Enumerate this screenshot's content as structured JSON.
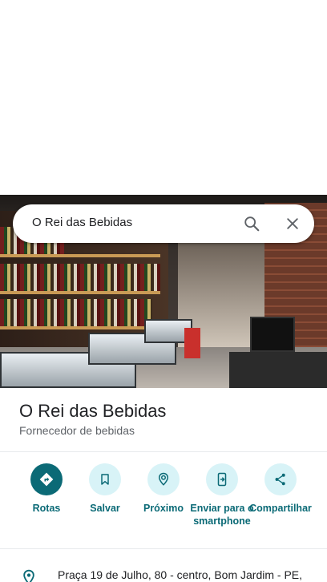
{
  "search": {
    "query": "O Rei das Bebidas",
    "search_icon": "search-icon",
    "clear_icon": "close-icon"
  },
  "photo": {
    "subject": "store-photo"
  },
  "place": {
    "name": "O Rei das Bebidas",
    "category": "Fornecedor de bebidas"
  },
  "actions": [
    {
      "id": "rotas",
      "label": "Rotas",
      "icon": "directions-icon"
    },
    {
      "id": "salvar",
      "label": "Salvar",
      "icon": "bookmark-icon"
    },
    {
      "id": "proximo",
      "label": "Próximo",
      "icon": "nearby-icon"
    },
    {
      "id": "enviar",
      "label": "Enviar para o smartphone",
      "icon": "send-to-phone-icon"
    },
    {
      "id": "compartilhar",
      "label": "Compartilhar",
      "icon": "share-icon"
    }
  ],
  "address": {
    "text": "Praça 19 de Julho, 80 - centro, Bom Jardim - PE,",
    "icon": "location-pin-icon"
  },
  "colors": {
    "accent": "#0b6a76",
    "accent_light": "#d8f3f7",
    "text": "#202124",
    "secondary_text": "#5f6368"
  }
}
